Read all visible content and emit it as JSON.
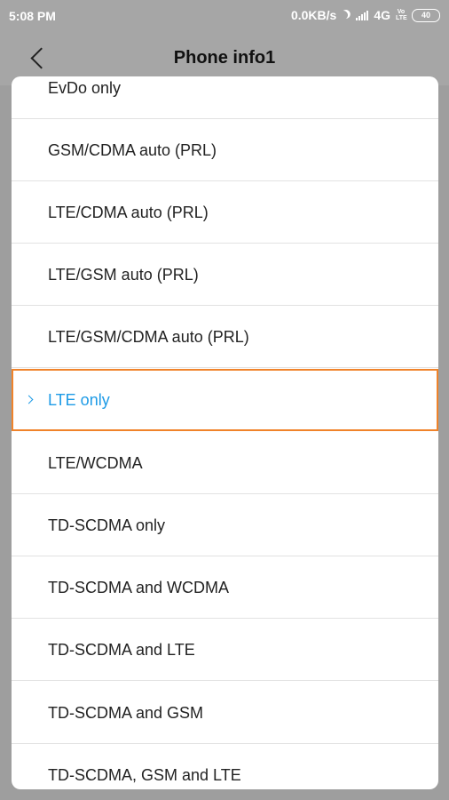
{
  "status_bar": {
    "time": "5:08 PM",
    "network_speed": "0.0KB/s",
    "network_type": "4G",
    "volte": "Vo LTE",
    "battery": "40"
  },
  "header": {
    "title": "Phone info1"
  },
  "dialog": {
    "options": [
      {
        "label": "EvDo only"
      },
      {
        "label": "GSM/CDMA auto (PRL)"
      },
      {
        "label": "LTE/CDMA auto (PRL)"
      },
      {
        "label": "LTE/GSM auto (PRL)"
      },
      {
        "label": "LTE/GSM/CDMA auto (PRL)"
      },
      {
        "label": "LTE only",
        "selected": true
      },
      {
        "label": "LTE/WCDMA"
      },
      {
        "label": "TD-SCDMA only"
      },
      {
        "label": "TD-SCDMA and WCDMA"
      },
      {
        "label": "TD-SCDMA and LTE"
      },
      {
        "label": "TD-SCDMA and GSM"
      },
      {
        "label": "TD-SCDMA, GSM and LTE"
      }
    ]
  },
  "colors": {
    "selected_text": "#1e9be6",
    "selected_border": "#f0832a",
    "dim_background": "#a6a6a6"
  }
}
